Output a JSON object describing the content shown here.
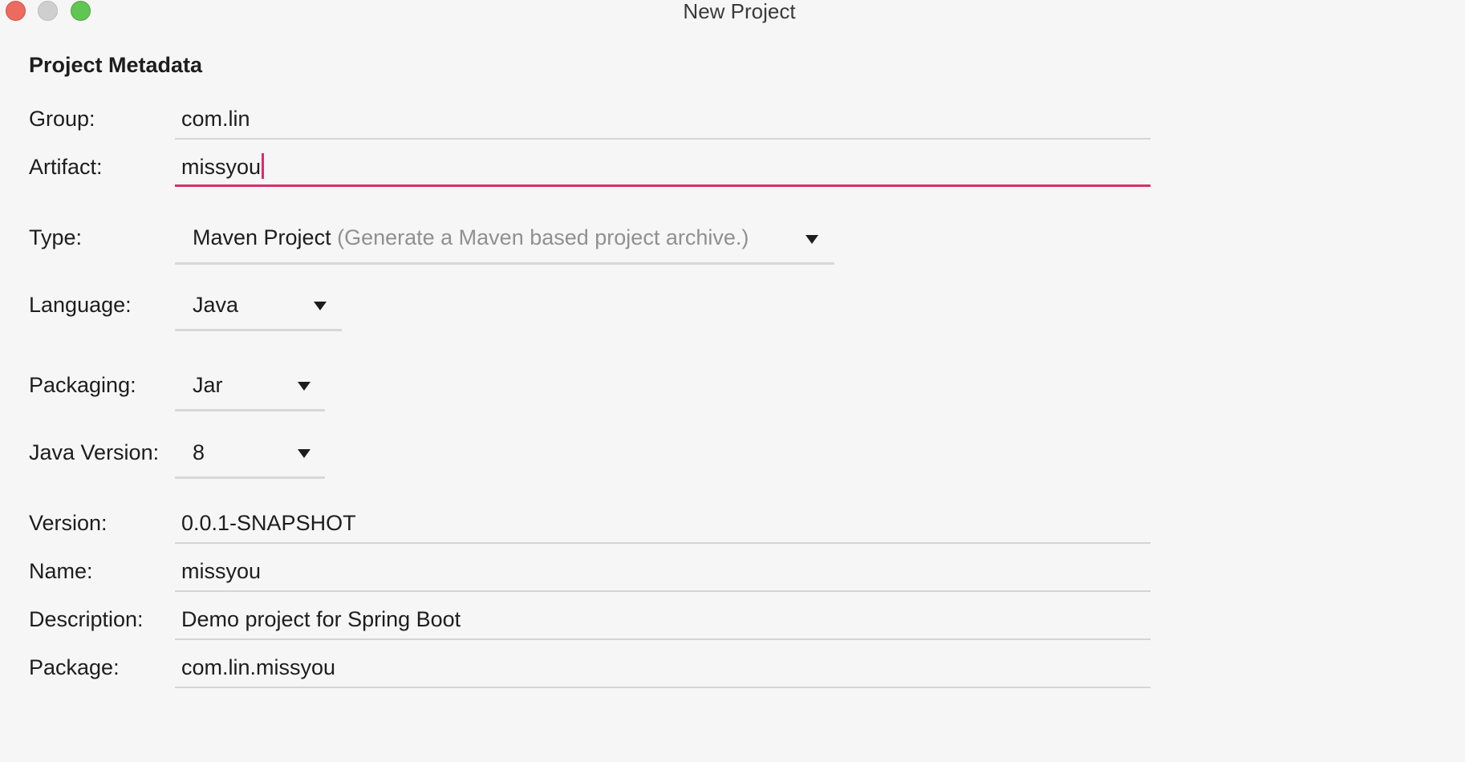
{
  "window": {
    "title": "New Project"
  },
  "section": {
    "heading": "Project Metadata"
  },
  "form": {
    "group": {
      "label": "Group:",
      "value": "com.lin"
    },
    "artifact": {
      "label": "Artifact:",
      "value": "missyou"
    },
    "type": {
      "label": "Type:",
      "value": "Maven Project",
      "hint": "(Generate a Maven based project archive.)"
    },
    "language": {
      "label": "Language:",
      "value": "Java"
    },
    "packaging": {
      "label": "Packaging:",
      "value": "Jar"
    },
    "java_version": {
      "label": "Java Version:",
      "value": "8"
    },
    "version": {
      "label": "Version:",
      "value": "0.0.1-SNAPSHOT"
    },
    "name": {
      "label": "Name:",
      "value": "missyou"
    },
    "description": {
      "label": "Description:",
      "value": "Demo project for Spring Boot"
    },
    "package": {
      "label": "Package:",
      "value": "com.lin.missyou"
    }
  },
  "colors": {
    "focus_accent": "#d62f6b",
    "close": "#ed6a5e",
    "minimize": "#cfcfcf",
    "maximize": "#61c554"
  }
}
